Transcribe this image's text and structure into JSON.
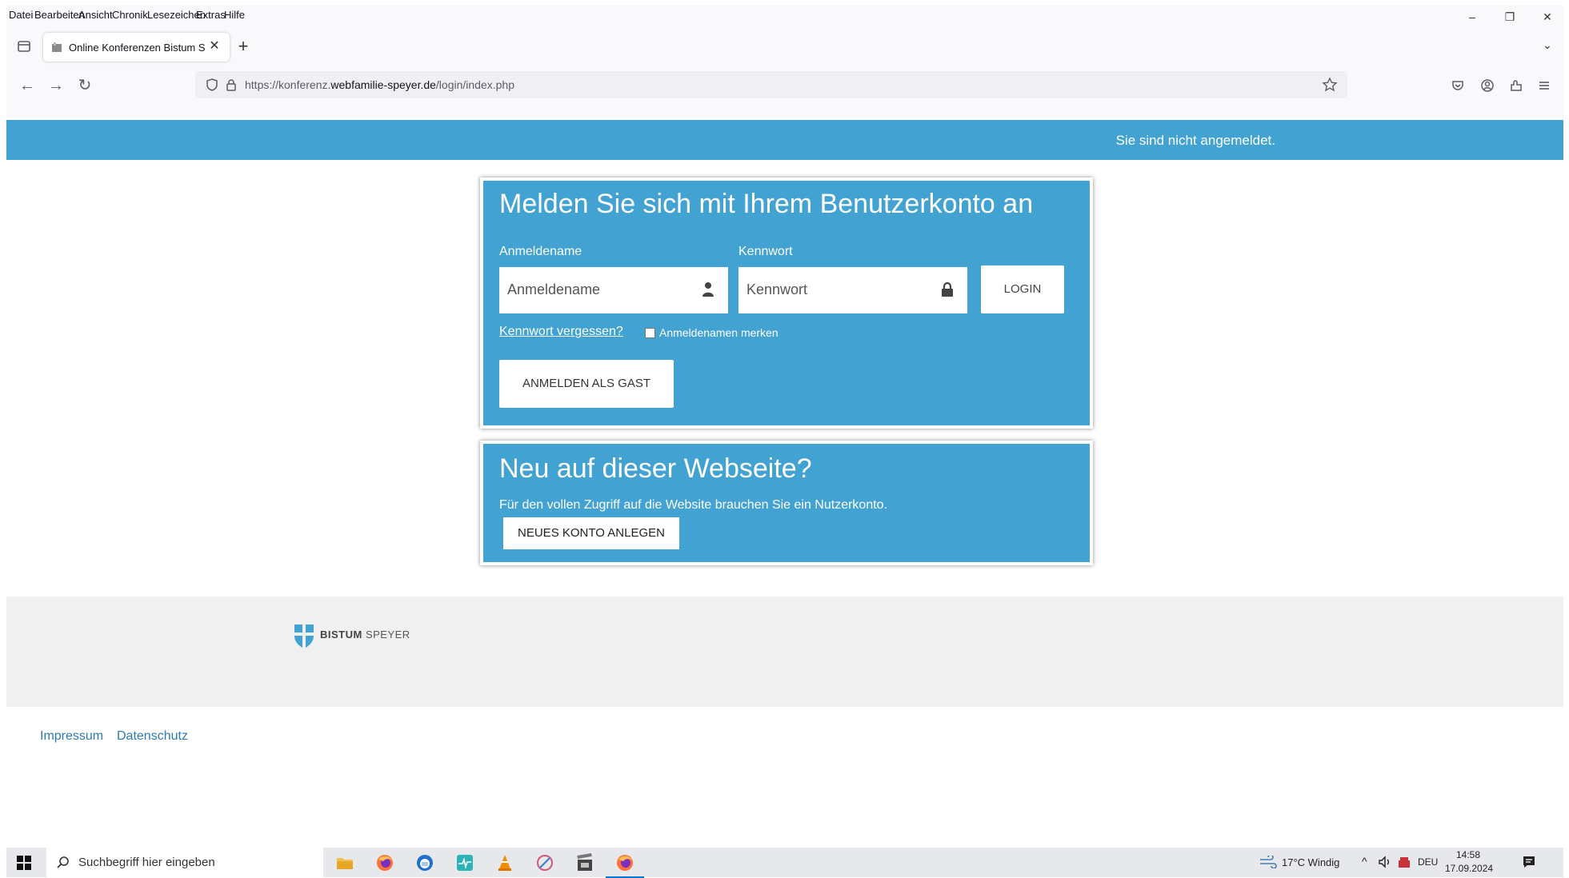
{
  "browser": {
    "menu": [
      "Datei",
      "Bearbeiten",
      "Ansicht",
      "Chronik",
      "Lesezeichen",
      "Extras",
      "Hilfe"
    ],
    "window_controls": {
      "minimize": "–",
      "restore": "❐",
      "close": "✕"
    },
    "tab": {
      "title": "Online Konferenzen Bistum Speyer",
      "close": "✕"
    },
    "new_tab": "+",
    "tab_list": "⌄",
    "nav": {
      "back": "←",
      "forward": "→",
      "reload": "↻"
    },
    "url": {
      "prefix": "https://konferenz.",
      "domain": "webfamilie-speyer.de",
      "path": "/login/index.php"
    }
  },
  "page": {
    "status_text": "Sie sind nicht angemeldet.",
    "login": {
      "heading": "Melden Sie sich mit Ihrem Benutzerkonto an",
      "username_label": "Anmeldename",
      "username_placeholder": "Anmeldename",
      "password_label": "Kennwort",
      "password_placeholder": "Kennwort",
      "login_button": "LOGIN",
      "forgot_link": "Kennwort vergessen?",
      "remember_label": "Anmeldenamen merken",
      "guest_button": "ANMELDEN ALS GAST"
    },
    "signup": {
      "heading": "Neu auf dieser Webseite?",
      "description": "Für den vollen Zugriff auf die Website brauchen Sie ein Nutzerkonto.",
      "button": "NEUES KONTO ANLEGEN"
    },
    "footer": {
      "logo_bold": "BISTUM",
      "logo_rest": " SPEYER",
      "links": [
        "Impressum",
        "Datenschutz"
      ]
    }
  },
  "taskbar": {
    "search_placeholder": "Suchbegriff hier eingeben",
    "weather": "17°C  Windig",
    "language": "DEU",
    "time": "14:58",
    "date": "17.09.2024"
  },
  "colors": {
    "brand_blue": "#42a2d1",
    "link_blue": "#2a7bb3"
  }
}
